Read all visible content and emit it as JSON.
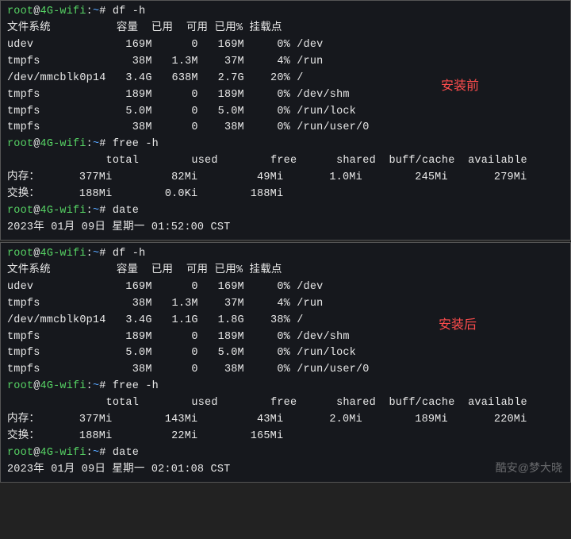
{
  "prompt": {
    "user": "root",
    "host": "4G-wifi",
    "path": "~",
    "symbol": "#"
  },
  "cmd": {
    "df": "df -h",
    "free": "free -h",
    "date": "date"
  },
  "before": {
    "annotation": "安装前",
    "df_header": {
      "fs": "文件系统",
      "size": "容量",
      "used": "已用",
      "avail": "可用",
      "pct": "已用%",
      "mount": "挂载点"
    },
    "df_rows": [
      {
        "fs": "udev",
        "size": "169M",
        "used": "0",
        "avail": "169M",
        "pct": "0%",
        "mount": "/dev"
      },
      {
        "fs": "tmpfs",
        "size": "38M",
        "used": "1.3M",
        "avail": "37M",
        "pct": "4%",
        "mount": "/run"
      },
      {
        "fs": "/dev/mmcblk0p14",
        "size": "3.4G",
        "used": "638M",
        "avail": "2.7G",
        "pct": "20%",
        "mount": "/"
      },
      {
        "fs": "tmpfs",
        "size": "189M",
        "used": "0",
        "avail": "189M",
        "pct": "0%",
        "mount": "/dev/shm"
      },
      {
        "fs": "tmpfs",
        "size": "5.0M",
        "used": "0",
        "avail": "5.0M",
        "pct": "0%",
        "mount": "/run/lock"
      },
      {
        "fs": "tmpfs",
        "size": "38M",
        "used": "0",
        "avail": "38M",
        "pct": "0%",
        "mount": "/run/user/0"
      }
    ],
    "free_header": {
      "total": "total",
      "used": "used",
      "free": "free",
      "shared": "shared",
      "buff": "buff/cache",
      "avail": "available"
    },
    "free_rows": [
      {
        "label": "内存：",
        "total": "377Mi",
        "used": "82Mi",
        "free": "49Mi",
        "shared": "1.0Mi",
        "buff": "245Mi",
        "avail": "279Mi"
      },
      {
        "label": "交换：",
        "total": "188Mi",
        "used": "0.0Ki",
        "free": "188Mi",
        "shared": "",
        "buff": "",
        "avail": ""
      }
    ],
    "date_output": "2023年 01月 09日 星期一 01:52:00 CST"
  },
  "after": {
    "annotation": "安装后",
    "df_header": {
      "fs": "文件系统",
      "size": "容量",
      "used": "已用",
      "avail": "可用",
      "pct": "已用%",
      "mount": "挂载点"
    },
    "df_rows": [
      {
        "fs": "udev",
        "size": "169M",
        "used": "0",
        "avail": "169M",
        "pct": "0%",
        "mount": "/dev"
      },
      {
        "fs": "tmpfs",
        "size": "38M",
        "used": "1.3M",
        "avail": "37M",
        "pct": "4%",
        "mount": "/run"
      },
      {
        "fs": "/dev/mmcblk0p14",
        "size": "3.4G",
        "used": "1.1G",
        "avail": "1.8G",
        "pct": "38%",
        "mount": "/"
      },
      {
        "fs": "tmpfs",
        "size": "189M",
        "used": "0",
        "avail": "189M",
        "pct": "0%",
        "mount": "/dev/shm"
      },
      {
        "fs": "tmpfs",
        "size": "5.0M",
        "used": "0",
        "avail": "5.0M",
        "pct": "0%",
        "mount": "/run/lock"
      },
      {
        "fs": "tmpfs",
        "size": "38M",
        "used": "0",
        "avail": "38M",
        "pct": "0%",
        "mount": "/run/user/0"
      }
    ],
    "free_header": {
      "total": "total",
      "used": "used",
      "free": "free",
      "shared": "shared",
      "buff": "buff/cache",
      "avail": "available"
    },
    "free_rows": [
      {
        "label": "内存：",
        "total": "377Mi",
        "used": "143Mi",
        "free": "43Mi",
        "shared": "2.0Mi",
        "buff": "189Mi",
        "avail": "220Mi"
      },
      {
        "label": "交换：",
        "total": "188Mi",
        "used": "22Mi",
        "free": "165Mi",
        "shared": "",
        "buff": "",
        "avail": ""
      }
    ],
    "date_output": "2023年 01月 09日 星期一 02:01:08 CST"
  },
  "watermark": "酷安@梦大晓"
}
